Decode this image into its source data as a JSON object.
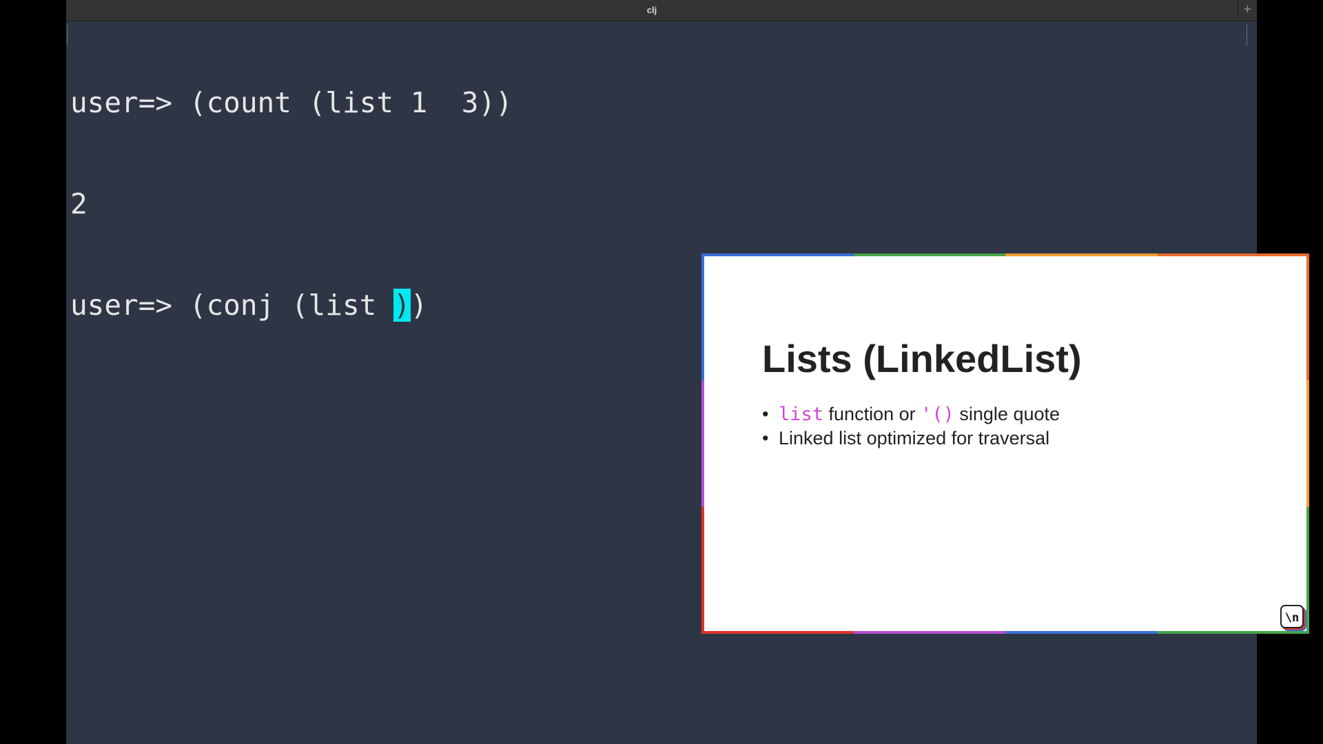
{
  "window": {
    "title": "clj",
    "new_tab_glyph": "+"
  },
  "terminal": {
    "line1": "user=> (count (list 1  3))",
    "line2": "2",
    "line3_prefix": "user=> (conj (list ",
    "line3_cursor": ")",
    "line3_suffix": ")"
  },
  "slide": {
    "title": "Lists (LinkedList)",
    "bullet1": {
      "code1": "list",
      "text1": " function or ",
      "code2": "'()",
      "text2": " single quote"
    },
    "bullet2": "Linked list optimized for traversal",
    "logo_text": "\\n",
    "border_colors": {
      "top": [
        "#3b6fd8",
        "#47a44a",
        "#f0a030",
        "#e86a2e"
      ],
      "bottom": [
        "#e0322c",
        "#b54fd0",
        "#3b6fd8",
        "#47a44a"
      ],
      "left": [
        "#3b6fd8",
        "#b54fd0",
        "#e0322c"
      ],
      "right": [
        "#e86a2e",
        "#f0a030",
        "#47a44a"
      ]
    }
  }
}
